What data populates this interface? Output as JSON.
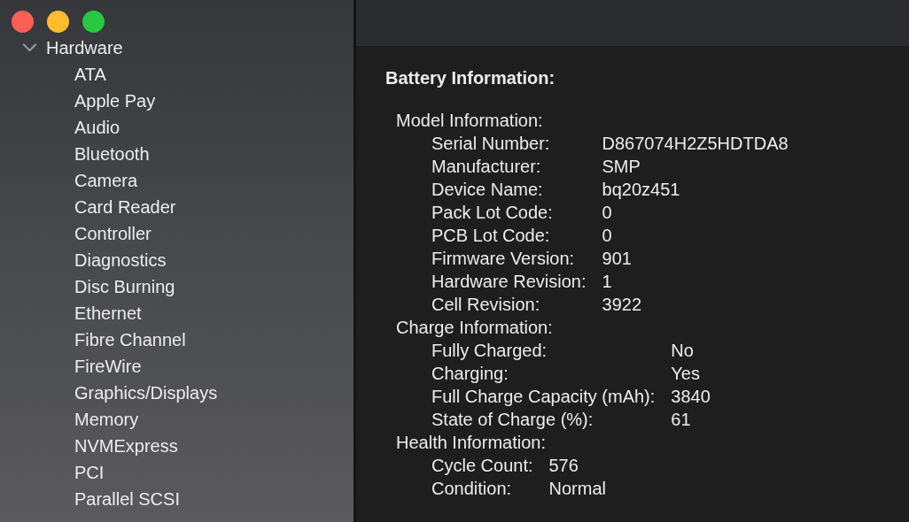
{
  "sidebar": {
    "items": [
      {
        "label": "Hardware",
        "expanded": true,
        "children": [
          {
            "label": "ATA"
          },
          {
            "label": "Apple Pay"
          },
          {
            "label": "Audio"
          },
          {
            "label": "Bluetooth"
          },
          {
            "label": "Camera"
          },
          {
            "label": "Card Reader"
          },
          {
            "label": "Controller"
          },
          {
            "label": "Diagnostics"
          },
          {
            "label": "Disc Burning"
          },
          {
            "label": "Ethernet"
          },
          {
            "label": "Fibre Channel"
          },
          {
            "label": "FireWire"
          },
          {
            "label": "Graphics/Displays"
          },
          {
            "label": "Memory"
          },
          {
            "label": "NVMExpress"
          },
          {
            "label": "PCI"
          },
          {
            "label": "Parallel SCSI"
          }
        ]
      }
    ]
  },
  "content": {
    "title": "Battery Information:",
    "sections": [
      {
        "heading": "Model Information:",
        "rows": [
          {
            "label": "Serial Number:",
            "value": "D867074H2Z5HDTDA8"
          },
          {
            "label": "Manufacturer:",
            "value": "SMP"
          },
          {
            "label": "Device Name:",
            "value": "bq20z451"
          },
          {
            "label": "Pack Lot Code:",
            "value": "0"
          },
          {
            "label": "PCB Lot Code:",
            "value": "0"
          },
          {
            "label": "Firmware Version:",
            "value": "901"
          },
          {
            "label": "Hardware Revision:",
            "value": "1"
          },
          {
            "label": "Cell Revision:",
            "value": "3922"
          }
        ]
      },
      {
        "heading": "Charge Information:",
        "rows": [
          {
            "label": "Fully Charged:",
            "value": "No"
          },
          {
            "label": "Charging:",
            "value": "Yes"
          },
          {
            "label": "Full Charge Capacity (mAh):",
            "value": "3840"
          },
          {
            "label": "State of Charge (%):",
            "value": "61"
          }
        ]
      },
      {
        "heading": "Health Information:",
        "rows": [
          {
            "label": "Cycle Count:",
            "value": "576"
          },
          {
            "label": "Condition:",
            "value": "Normal"
          }
        ]
      }
    ]
  }
}
